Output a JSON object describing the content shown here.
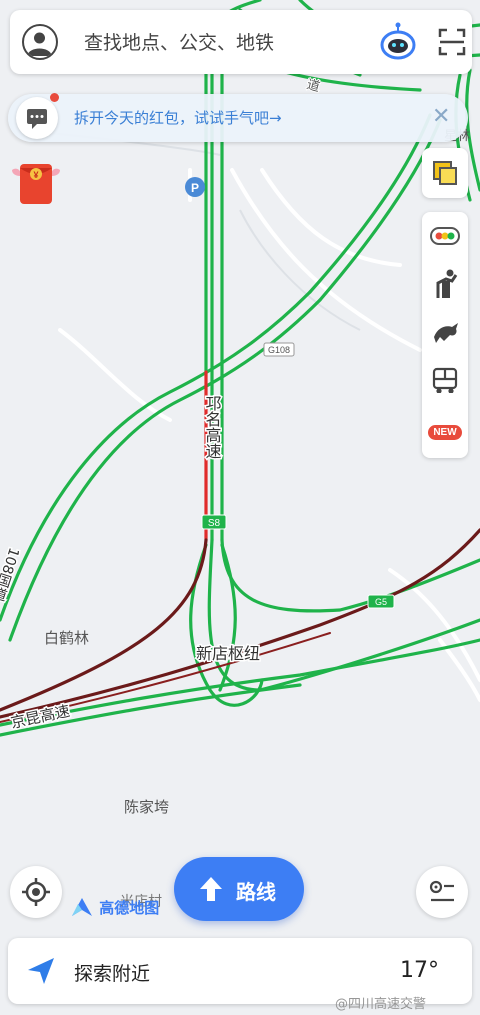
{
  "search": {
    "placeholder": "查找地点、公交、地铁"
  },
  "promo": {
    "text": "拆开今天的红包，试试手气吧→"
  },
  "map": {
    "road_labels": {
      "road_vertical": "邛名高速",
      "g108_vertical": "108国道",
      "jingkun": "京昆高速",
      "hub": "新店枢纽",
      "shield_s8": "S8",
      "shield_g108": "G108",
      "shield_g5": "G5",
      "top_road_fragment": "道",
      "top_right_fragment": "星林"
    },
    "place_labels": {
      "baihelin": "白鹤林",
      "chenjiawan": "陈家垮",
      "bottom_fragment": "米店村"
    },
    "colors": {
      "road_green": "#1fb34a",
      "road_red": "#e02b2b",
      "road_darkred": "#6b1a1a",
      "land": "#eef0f3",
      "accent_blue": "#3d7ef4"
    }
  },
  "toolbar": {
    "layers_icon": "layers-icon",
    "traffic_icon": "traffic-light-icon",
    "walk_icon": "walking-person-icon",
    "horse_icon": "horse-icon",
    "bus_icon": "bus-icon",
    "new_badge": "NEW"
  },
  "route_button": {
    "label": "路线"
  },
  "logo": {
    "text": "高德地图"
  },
  "bottom_bar": {
    "label": "探索附近",
    "temperature": "17°"
  },
  "watermark": "@四川高速交警"
}
